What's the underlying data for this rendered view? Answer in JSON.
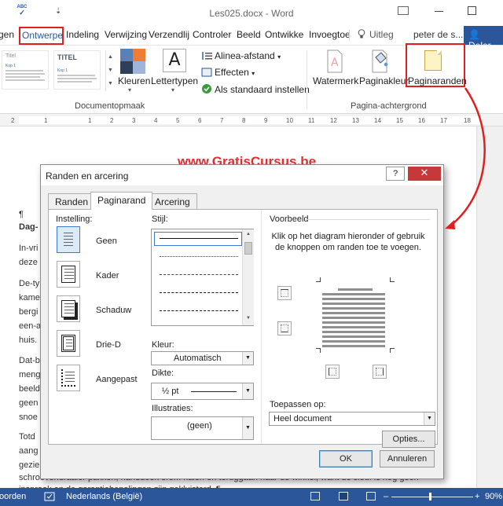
{
  "window": {
    "title": "Les025.docx - Word",
    "qat_spell": "ABC",
    "qat_spell_check": "✓",
    "qat_more": "⇣"
  },
  "tabs": [
    {
      "label": "gen"
    },
    {
      "label": "Ontwerpe"
    },
    {
      "label": "Indeling"
    },
    {
      "label": "Verwijzing"
    },
    {
      "label": "Verzendlij"
    },
    {
      "label": "Controler"
    },
    {
      "label": "Beeld"
    },
    {
      "label": "Ontwikke"
    },
    {
      "label": "Invoegtoe"
    },
    {
      "label": "Uitleg"
    },
    {
      "label": "peter de s..."
    },
    {
      "label": "Deler"
    }
  ],
  "ribbon": {
    "gallery": [
      {
        "title": "Titel",
        "head": "Kop 1"
      },
      {
        "title": "TITEL",
        "head": "Kop 1"
      }
    ],
    "colors_label": "Kleuren",
    "fonts_label": "Lettertypen",
    "fonts_glyph": "A",
    "paragraph_spacing": "Alinea-afstand",
    "effects": "Effecten",
    "set_default": "Als standaard instellen",
    "group_doc_format": "Documentopmaak",
    "watermark": "Watermerk",
    "page_color": "Paginakleur",
    "page_borders": "Paginaranden",
    "group_page_bg": "Pagina-achtergrond"
  },
  "ruler": {
    "ticks": [
      "2",
      "1",
      "1",
      "2",
      "3",
      "4",
      "5",
      "6",
      "7",
      "8",
      "9",
      "10",
      "11",
      "12",
      "13",
      "14",
      "15",
      "16",
      "17",
      "18"
    ]
  },
  "document": {
    "lines": [
      "¶",
      "Dag-",
      "In-vri",
      "deze",
      "De-ty",
      "kame",
      "bergi",
      "een-a",
      "huis.",
      "Dat-b",
      "meng",
      "beeld",
      "geen",
      "snoe",
      "Totd",
      "aang",
      "gezie",
      "schroevendraaier pakken, handdoek erom halen en teruggaan naar de winkel, want de sleuf is nog geen",
      "inspraak en de garantiebepalingen zijn gekluisterd. ¶"
    ],
    "watermark_text": "www.GratisCursus.be"
  },
  "dialog": {
    "title": "Randen en arcering",
    "help": "?",
    "close": "✕",
    "tabs": {
      "borders": "Randen",
      "page_border": "Paginarand",
      "shading": "Arcering"
    },
    "setting_label": "Instelling:",
    "settings": [
      "Geen",
      "Kader",
      "Schaduw",
      "Drie-D",
      "Aangepast"
    ],
    "style_label": "Stijl:",
    "color_label": "Kleur:",
    "color_value": "Automatisch",
    "width_label": "Dikte:",
    "width_value": "½ pt",
    "art_label": "Illustraties:",
    "art_value": "(geen)",
    "preview_label": "Voorbeeld",
    "preview_help": "Klik op het diagram hieronder of gebruik de knoppen om randen toe te voegen.",
    "apply_label": "Toepassen op:",
    "apply_value": "Heel document",
    "options_button": "Opties...",
    "ok_button": "OK",
    "cancel_button": "Annuleren"
  },
  "statusbar": {
    "left": "oorden",
    "language": "Nederlands (België)",
    "zoom": "90%"
  },
  "colors": {
    "accent": "#2b579a",
    "highlight": "#e02020"
  }
}
